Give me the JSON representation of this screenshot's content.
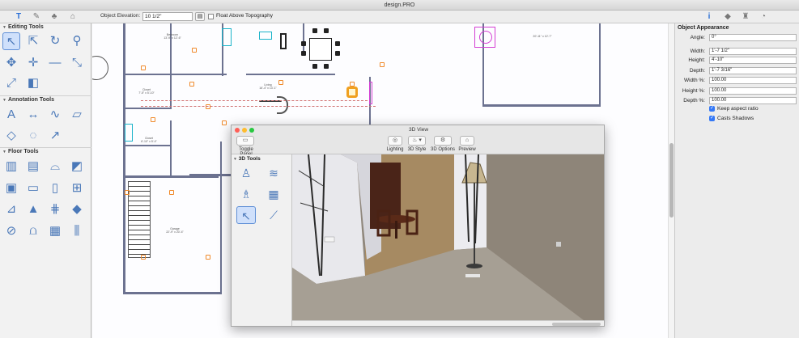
{
  "window": {
    "title": "design.PRO"
  },
  "toolbar": {
    "object_elevation_label": "Object Elevation:",
    "object_elevation_value": "10 1/2\"",
    "float_above_label": "Float Above Topography",
    "left_tabs": [
      "text-tool-icon",
      "paintbrush-icon",
      "tree-icon",
      "house-icon"
    ],
    "right_tabs": [
      "info-icon",
      "tag-icon",
      "hydrant-icon",
      "timer-icon"
    ]
  },
  "left_panel": {
    "sections": [
      {
        "title": "Editing Tools"
      },
      {
        "title": "Annotation Tools"
      },
      {
        "title": "Floor Tools"
      }
    ]
  },
  "view3d": {
    "title": "3D View",
    "toggle_panel_label": "Toggle Panel",
    "buttons": [
      {
        "label": "Lighting",
        "icon": "lightbulb-icon"
      },
      {
        "label": "3D Style",
        "icon": "brush-icon"
      },
      {
        "label": "3D Options",
        "icon": "gear-icon"
      },
      {
        "label": "Preview",
        "icon": "house-icon"
      }
    ],
    "tools_header": "3D Tools"
  },
  "object_appearance": {
    "title": "Object Appearance",
    "angle_label": "Angle:",
    "angle": "0°",
    "width_label": "Width:",
    "width": "1'-7 1/2\"",
    "height_label": "Height:",
    "height": "4'-10\"",
    "depth_label": "Depth:",
    "depth": "1'-7 3/16\"",
    "width_pct_label": "Width %:",
    "width_pct": "100.00",
    "height_pct_label": "Height %:",
    "height_pct": "100.00",
    "depth_pct_label": "Depth %:",
    "depth_pct": "100.00",
    "keep_aspect_label": "Keep aspect ratio",
    "casts_shadows_label": "Casts Shadows"
  },
  "colors": {
    "accent": "#3478f6",
    "wall": "#6c7290",
    "fixture": "#f08a2a"
  }
}
